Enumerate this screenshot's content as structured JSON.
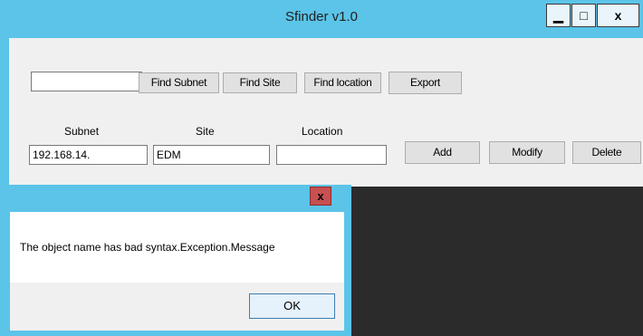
{
  "main_window": {
    "title": "Sfinder v1.0",
    "controls": {
      "minimize": "▁",
      "maximize": "□",
      "close": "x"
    }
  },
  "search": {
    "input_value": "",
    "buttons": [
      "Find Subnet",
      "Find Site",
      "Find location",
      "Export"
    ]
  },
  "fields": {
    "labels": {
      "subnet": "Subnet",
      "site": "Site",
      "location": "Location"
    },
    "values": {
      "subnet": "192.168.14.",
      "site": "EDM",
      "location": ""
    }
  },
  "actions": {
    "add": "Add",
    "modify": "Modify",
    "delete": "Delete"
  },
  "dialog": {
    "close": "x",
    "message": "The object name has bad syntax.Exception.Message",
    "ok": "OK"
  },
  "colors": {
    "window_frame": "#5bc4e8",
    "client": "#f0f0f0",
    "close_red": "#c75050",
    "background": "#2b2b2b"
  }
}
